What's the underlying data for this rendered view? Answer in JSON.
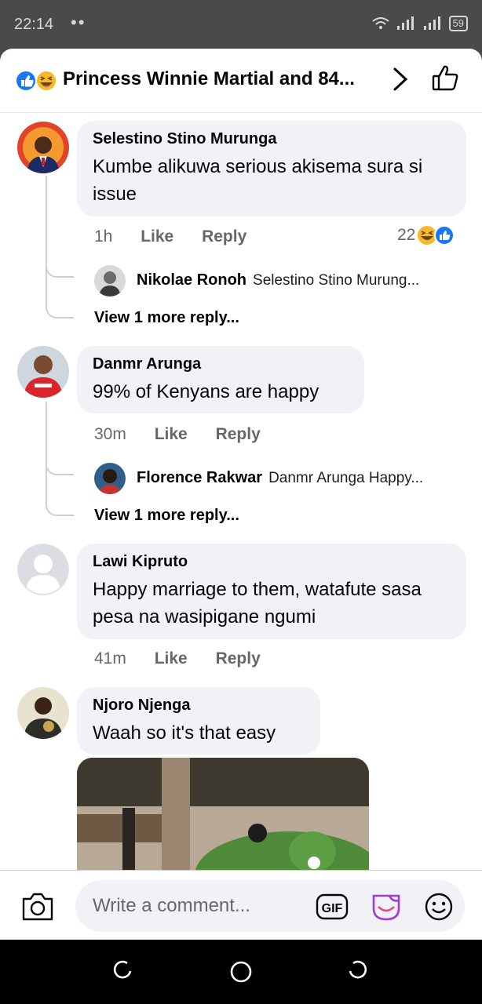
{
  "status_bar": {
    "time": "22:14",
    "dots": "••",
    "battery": "59"
  },
  "header": {
    "title": "Princess Winnie Martial and 84...",
    "reaction_icons": [
      "like-icon",
      "haha-icon"
    ]
  },
  "comments": [
    {
      "author": "Selestino Stino Murunga",
      "text": "Kumbe alikuwa serious akisema sura si issue",
      "time": "1h",
      "like_label": "Like",
      "reply_label": "Reply",
      "reaction_count": "22",
      "reply_preview": {
        "author": "Nikolae Ronoh",
        "snippet": "Selestino Stino Murung..."
      },
      "view_more": "View 1 more reply..."
    },
    {
      "author": "Danmr Arunga",
      "text": "99% of Kenyans are happy",
      "time": "30m",
      "like_label": "Like",
      "reply_label": "Reply",
      "reply_preview": {
        "author": "Florence Rakwar",
        "snippet": "Danmr Arunga Happy..."
      },
      "view_more": "View 1 more reply..."
    },
    {
      "author": "Lawi Kipruto",
      "text": "Happy marriage to them, watafute sasa pesa na wasipigane ngumi",
      "time": "41m",
      "like_label": "Like",
      "reply_label": "Reply"
    },
    {
      "author": "Njoro Njenga",
      "text": "Waah so it's that easy"
    }
  ],
  "composer": {
    "placeholder": "Write a comment...",
    "gif_label": "GIF"
  },
  "colors": {
    "like_blue": "#1877f2",
    "bubble_gray": "#f0f2f5",
    "meta_gray": "#65676b",
    "haha_yellow": "#f7b928"
  }
}
